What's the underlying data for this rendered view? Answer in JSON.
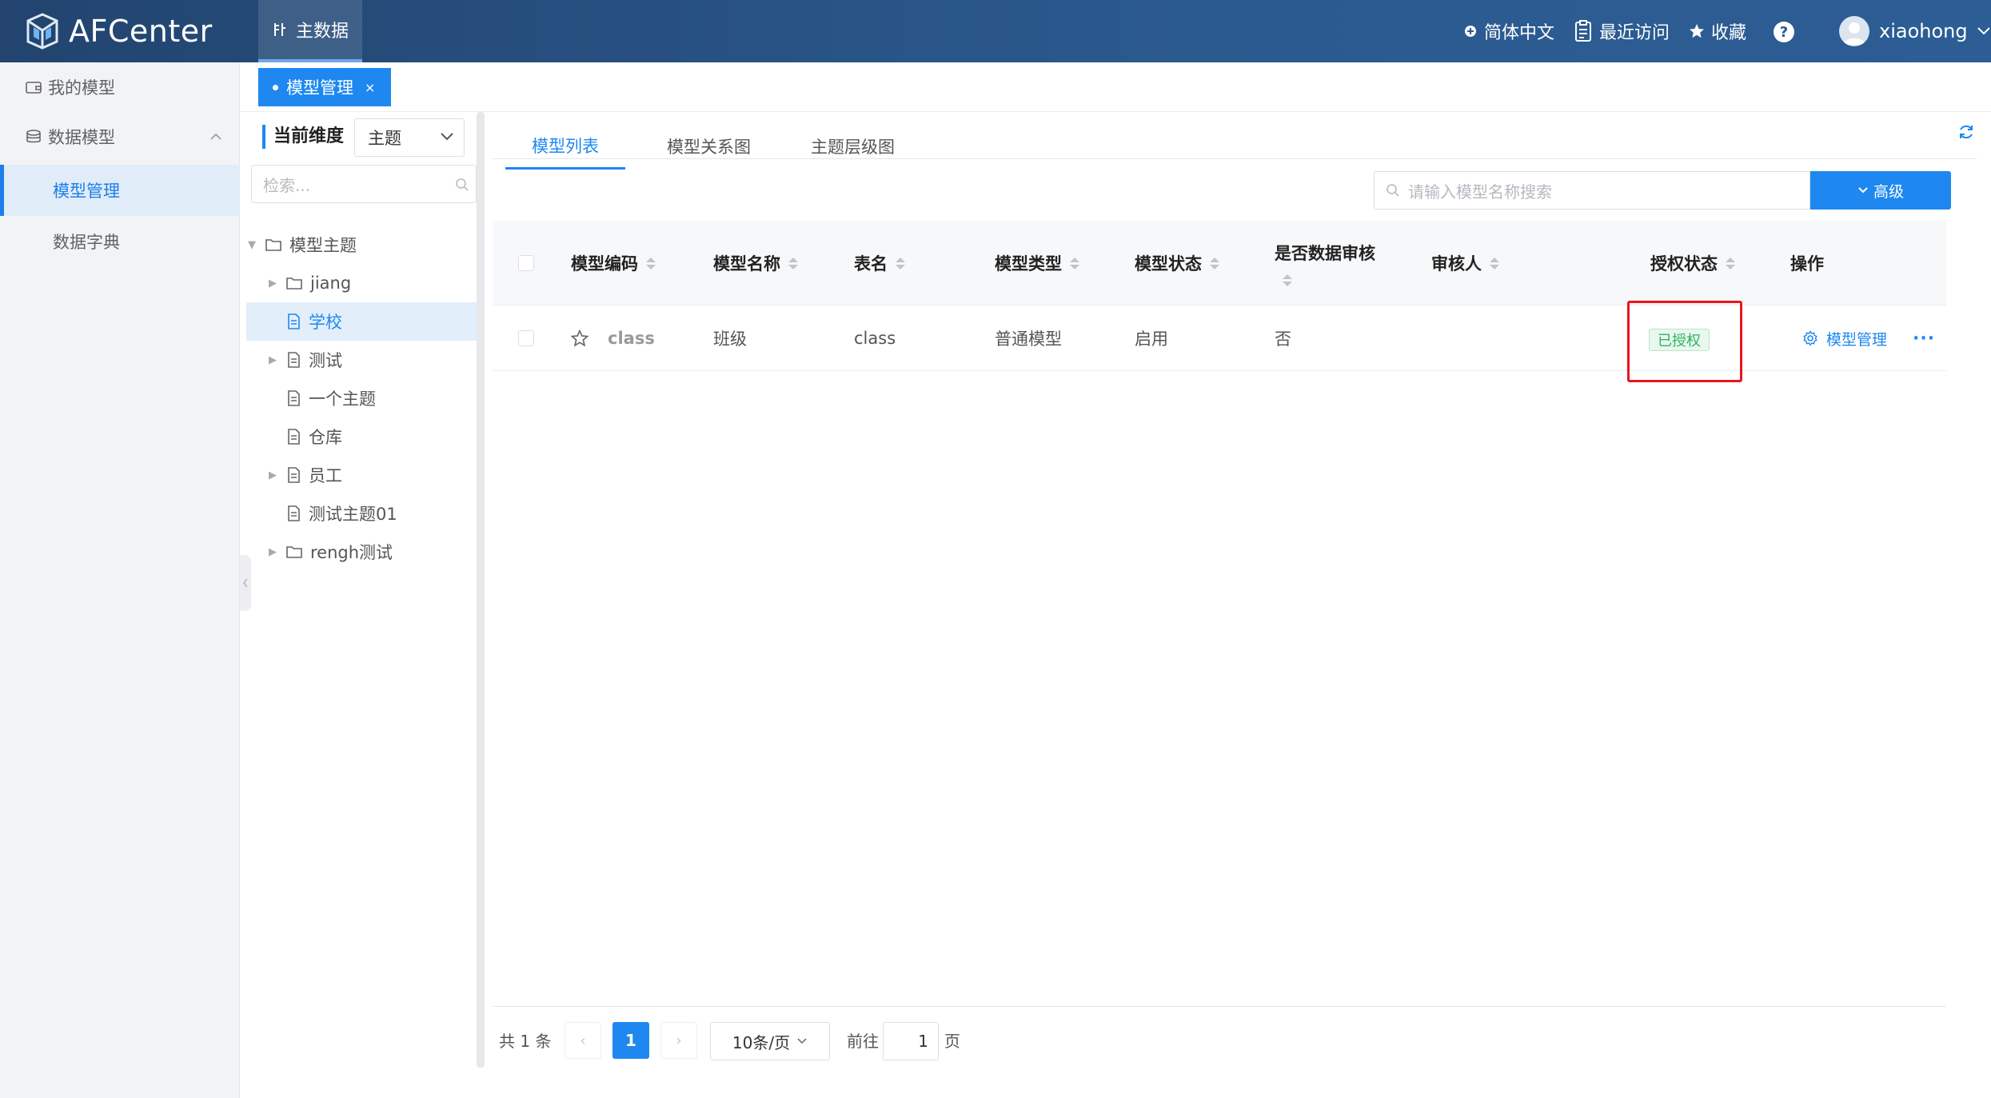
{
  "app": {
    "name": "AFCenter"
  },
  "topnav": {
    "main_label": "主数据",
    "language": "简体中文",
    "recent": "最近访问",
    "favorites": "收藏",
    "help": "?",
    "username": "xiaohong"
  },
  "leftmenu": {
    "my_models": "我的模型",
    "data_models": "数据模型",
    "model_management": "模型管理",
    "data_dictionary": "数据字典"
  },
  "tabbar": {
    "active_tab": "模型管理",
    "close": "×"
  },
  "tree": {
    "dimension_label": "当前维度",
    "dimension_value": "主题",
    "search_placeholder": "检索...",
    "root": "模型主题",
    "items": [
      "jiang",
      "学校",
      "测试",
      "一个主题",
      "仓库",
      "员工",
      "测试主题01",
      "rengh测试"
    ]
  },
  "main": {
    "tabs": [
      "模型列表",
      "模型关系图",
      "主题层级图"
    ],
    "search_placeholder": "请输入模型名称搜索",
    "advanced_button": "高级",
    "columns": [
      "模型编码",
      "模型名称",
      "表名",
      "模型类型",
      "模型状态",
      "是否数据审核",
      "审核人",
      "授权状态",
      "操作"
    ],
    "rows": [
      {
        "code": "class",
        "name": "班级",
        "table": "class",
        "type": "普通模型",
        "status": "启用",
        "audit": "否",
        "reviewer": "",
        "auth": "已授权",
        "action": "模型管理",
        "more": "···"
      }
    ],
    "colors": {
      "accent": "#1e88f0",
      "highlight": "#e8161d",
      "auth_green": "#2db55d"
    }
  },
  "pagination": {
    "total": "共 1 条",
    "prev": "‹",
    "current": "1",
    "next": "›",
    "page_size": "10条/页",
    "goto_label": "前往",
    "goto_value": "1",
    "page_suffix": "页"
  }
}
